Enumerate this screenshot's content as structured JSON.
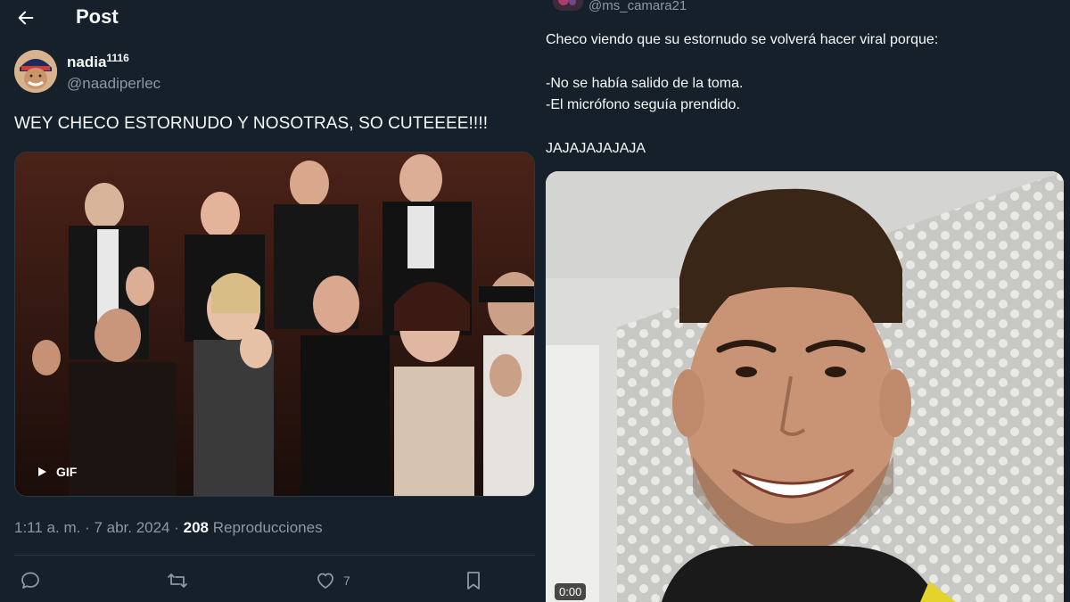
{
  "header": {
    "title": "Post"
  },
  "post": {
    "author_name": "nadia",
    "author_sup": "1116",
    "author_handle": "@naadiperlec",
    "text": "WEY CHECO ESTORNUDO Y NOSOTRAS, SO CUTEEEE!!!!",
    "media_badge": "GIF",
    "time": "1:11 a. m. · 7 abr. 2024 · ",
    "views_count": "208",
    "views_label": " Reproducciones",
    "likes": "7"
  },
  "quoted": {
    "handle": "@ms_camara21",
    "line1": "Checo viendo que su estornudo se volverá hacer viral porque:",
    "line2": "-No se había salido de la toma.",
    "line3": "-El micrófono seguía prendido.",
    "line4": "JAJAJAJAJAJA",
    "video_time": "0:00"
  },
  "icons": {
    "back": "arrow-left-icon",
    "reply": "reply-icon",
    "repost": "repost-icon",
    "like": "heart-icon",
    "bookmark": "bookmark-icon",
    "play": "play-icon"
  },
  "colors": {
    "background": "#15202b",
    "text_primary": "#f7f9f9",
    "text_secondary": "#8b98a5",
    "divider": "#2f3a45"
  }
}
